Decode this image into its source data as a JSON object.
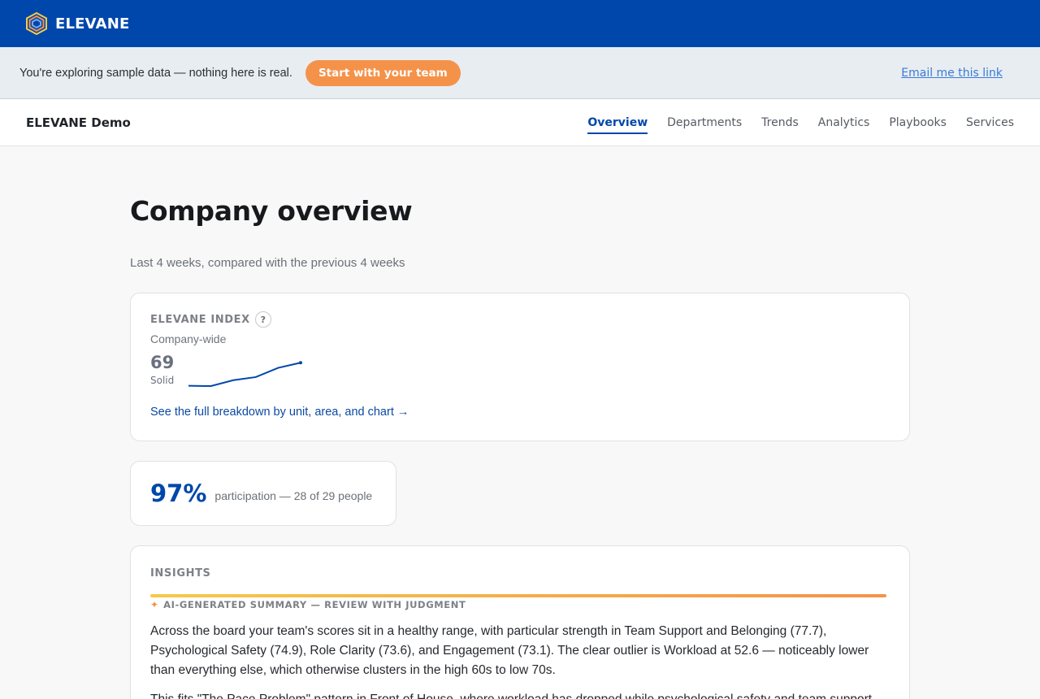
{
  "brand": {
    "name": "ELEVANE",
    "color": "#0047ab",
    "accent": "#f5924a"
  },
  "banner": {
    "text": "You're exploring sample data — nothing here is real.",
    "cta": "Start with your team",
    "email_link": "Email me this link"
  },
  "subnav": {
    "demo_name": "ELEVANE Demo",
    "tabs": [
      {
        "label": "Overview",
        "active": true
      },
      {
        "label": "Departments"
      },
      {
        "label": "Trends"
      },
      {
        "label": "Analytics"
      },
      {
        "label": "Playbooks"
      },
      {
        "label": "Services"
      }
    ]
  },
  "page": {
    "title": "Company overview",
    "subtitle": "Last 4 weeks, compared with the previous 4 weeks"
  },
  "index_card": {
    "label": "ELEVANE INDEX",
    "help": "?",
    "scope": "Company-wide",
    "score": "69",
    "score_label": "Solid",
    "sparkline": [
      64.5,
      64.1,
      65.6,
      66.2,
      68.0,
      69.0
    ],
    "link": "See the full breakdown by unit, area, and chart →"
  },
  "participation": {
    "pct": "97%",
    "text": "participation — 28 of 29 people"
  },
  "insights": {
    "label": "INSIGHTS",
    "ai_icon": "sparkle-icon",
    "ai_label": "AI-GENERATED SUMMARY — REVIEW WITH JUDGMENT",
    "paragraphs": [
      "Across the board your team's scores sit in a healthy range, with particular strength in Team Support and Belonging (77.7), Psychological Safety (74.9), Role Clarity (73.6), and Engagement (73.1). The clear outlier is Workload at 52.6 — noticeably lower than everything else, which otherwise clusters in the high 60s to low 70s.",
      "This fits \"The Pace Problem\" pattern in Front of House, where workload has dropped while psychological safety and team support"
    ]
  }
}
